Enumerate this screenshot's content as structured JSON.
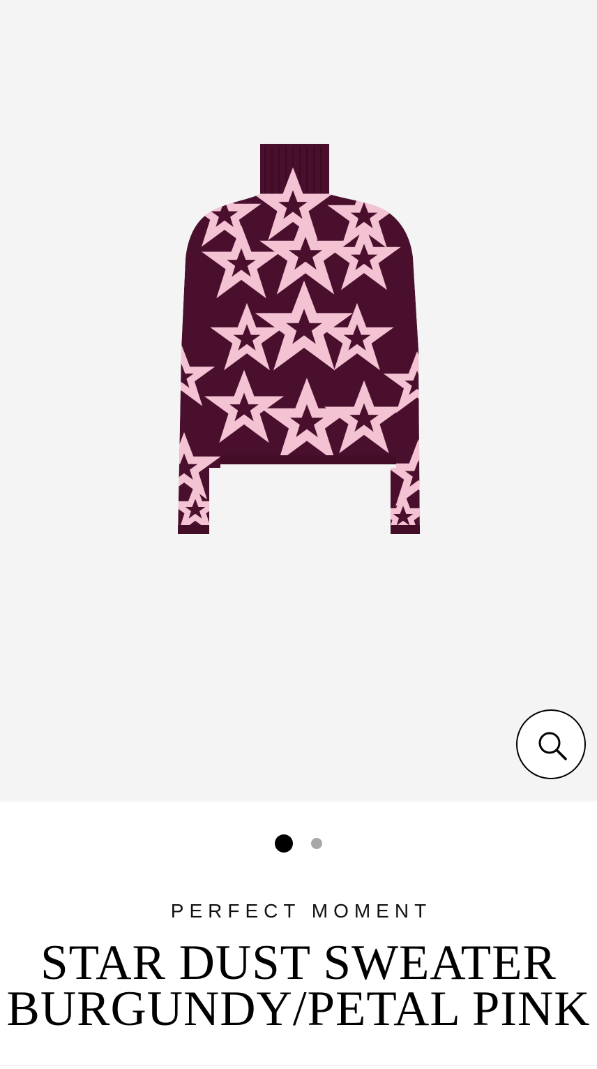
{
  "gallery": {
    "image": {
      "alt": "Star Dust Sweater Burgundy/Petal Pink",
      "body_color": "#4a0f2c",
      "pattern_color": "#f3c2d3",
      "background_color": "#f4f4f4"
    },
    "zoom_icon": "search-icon",
    "dots": {
      "count": 2,
      "active_index": 0
    }
  },
  "product": {
    "brand": "PERFECT MOMENT",
    "title_line1": "STAR DUST SWEATER",
    "title_line2": "BURGUNDY/PETAL PINK"
  }
}
